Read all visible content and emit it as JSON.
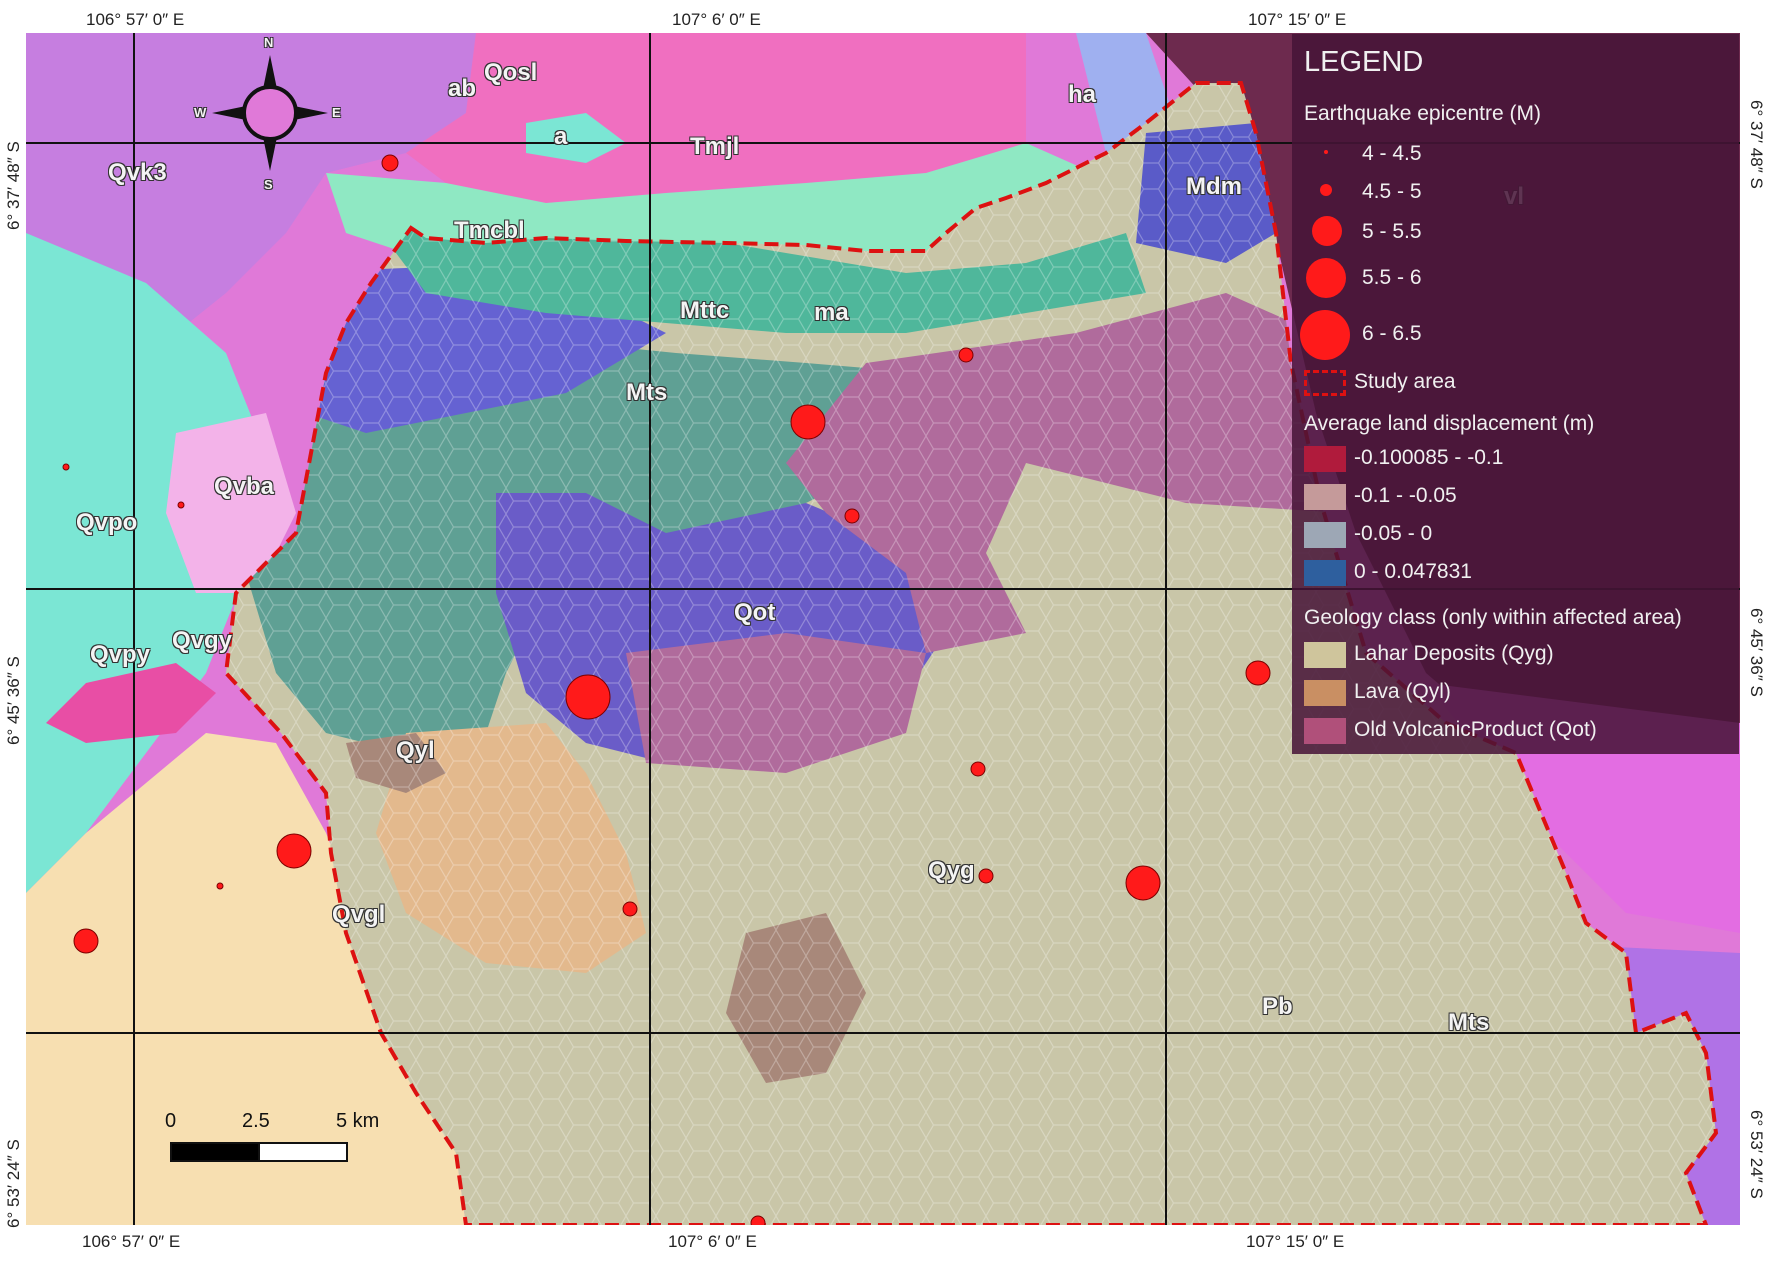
{
  "coords": {
    "top": [
      "106° 57′ 0″ E",
      "107° 6′ 0″ E",
      "107° 15′ 0″ E"
    ],
    "bottom": [
      "106° 57′ 0″ E",
      "107° 6′ 0″ E",
      "107° 15′ 0″ E"
    ],
    "left": [
      "6° 37′ 48″ S",
      "6° 45′ 36″ S",
      "6° 53′ 24″ S"
    ],
    "right": [
      "6° 37′ 48″ S",
      "6° 45′ 36″ S",
      "6° 53′ 24″ S"
    ]
  },
  "map_labels": {
    "qosl": "Qosl",
    "ab": "ab",
    "a": "a",
    "tmjl": "Tmjl",
    "qvk3": "Qvk3",
    "tmcbl": "Tmcbl",
    "ha": "ha",
    "mdm": "Mdm",
    "vl": "vl",
    "mttc": "Mttc",
    "ma": "ma",
    "mts": "Mts",
    "qvba": "Qvba",
    "qvpo": "Qvpo",
    "qvpy": "Qvpy",
    "qvgy": "Qvgy",
    "qot": "Qot",
    "qyl": "Qyl",
    "qyg": "Qyg",
    "qvgl": "Qvgl",
    "pb": "Pb",
    "mts2": "Mts"
  },
  "compass": {
    "n": "N",
    "s": "S",
    "e": "E",
    "w": "W"
  },
  "scale": {
    "t0": "0",
    "t1": "2.5",
    "t2": "5 km"
  },
  "legend": {
    "title": "LEGEND",
    "epicentre_heading": "Earthquake epicentre (M)",
    "magnitudes": [
      "4 - 4.5",
      "4.5 - 5",
      "5 - 5.5",
      "5.5 - 6",
      "6 - 6.5"
    ],
    "study_area": "Study area",
    "displacement_heading": "Average land displacement (m)",
    "displacement_classes": [
      "-0.100085 - -0.1",
      "-0.1 - -0.05",
      "-0.05 - 0",
      "0 - 0.047831"
    ],
    "geology_heading": "Geology class (only within affected area)",
    "geology_classes": [
      "Lahar Deposits (Qyg)",
      "Lava (Qyl)",
      "Old VolcanicProduct (Qot)"
    ]
  },
  "colors": {
    "epicentre": "#ff1a1a",
    "study_area_border": "#dd1111",
    "displacement": [
      "#b01b3c",
      "#c59a9a",
      "#9da7b5",
      "#2e5f9e"
    ],
    "geology": [
      "#cfc59c",
      "#c98f63",
      "#b0507a"
    ]
  }
}
